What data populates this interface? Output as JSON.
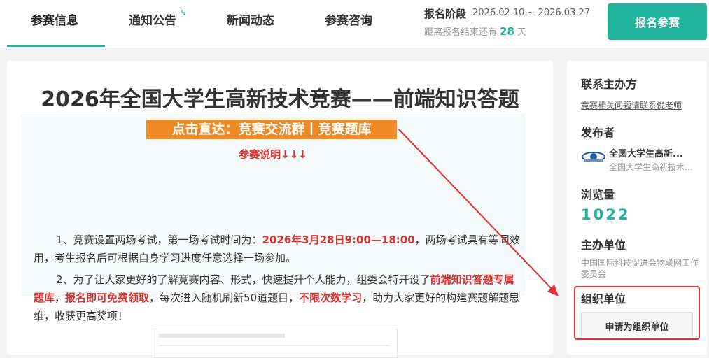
{
  "nav": {
    "tabs": [
      {
        "label": "参赛信息"
      },
      {
        "label": "通知公告",
        "badge": "5"
      },
      {
        "label": "新闻动态"
      },
      {
        "label": "参赛咨询"
      }
    ],
    "phase_label": "报名阶段",
    "phase_dates": "2026.02.10 ~ 2026.03.27",
    "remain_prefix": "距离报名结束还有",
    "remain_days": "28",
    "remain_suffix": "天",
    "signup_button": "报名参赛"
  },
  "main": {
    "title": "2026年全国大学生高新技术竞赛——前端知识答题",
    "quick_link": "点击直达：竞赛交流群丨竞赛题库",
    "note_heading": "参赛说明↓↓↓",
    "para1": {
      "a": "1、竞赛设置两场考试，第一场考试时间为：",
      "b": "2026年3月28日9:00—18:00",
      "c": "，两场考试具有等同效用，考生报名后可根据自身学习进度任意选择一场参加。"
    },
    "para2": {
      "a": "2、为了让大家更好的了解竞赛内容、形式，快速提升个人能力，组委会特开设了",
      "b": "前端知识答题专属题库",
      "c": "，",
      "d": "报名即可免费领取",
      "e": "，每次进入随机刷新50道题目，",
      "f": "不限次数学习",
      "g": "，助力大家更好的构建赛题解题思维，收获更高奖项！"
    }
  },
  "side": {
    "contact_heading": "联系主办方",
    "contact_link": "竞赛相关问题请联系倪老师",
    "publisher_heading": "发布者",
    "publisher_name": "全国大学生高新...",
    "publisher_sub": "全国大学生高新技术...",
    "views_heading": "浏览量",
    "views": "1022",
    "host_heading": "主办单位",
    "host_name": "中国国际科技促进会物联网工作委员会",
    "org_heading": "组织单位",
    "org_button": "申请为组织单位"
  },
  "colors": {
    "accent": "#1fb39c",
    "highlight_red": "#d7322f",
    "quick_bg": "#f08a24",
    "annotation_red": "#e53030"
  }
}
